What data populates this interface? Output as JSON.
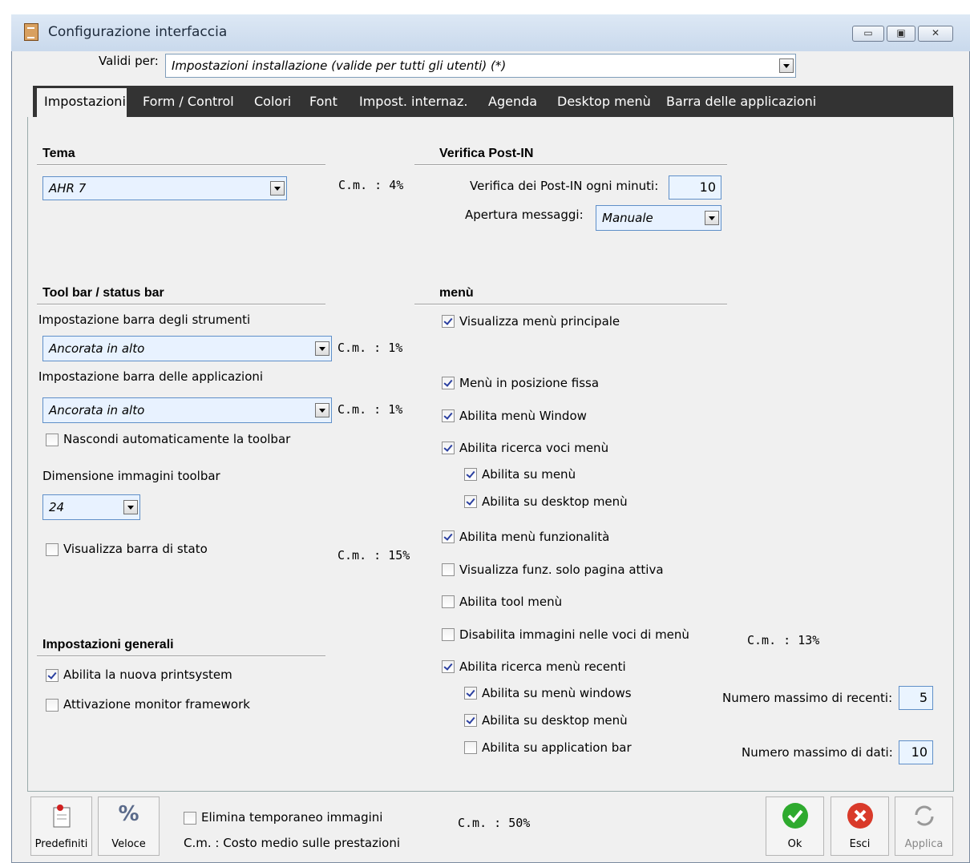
{
  "window": {
    "title": "Configurazione interfaccia",
    "controls": [
      "minimize",
      "maximize",
      "close"
    ]
  },
  "valid_for": {
    "label": "Validi per:",
    "value": "Impostazioni installazione (valide per tutti gli utenti) (*)"
  },
  "tabs": [
    "Impostazioni",
    "Form / Control",
    "Colori",
    "Font",
    "Impost. internaz.",
    "Agenda",
    "Desktop menù",
    "Barra delle applicazioni"
  ],
  "tema": {
    "title": "Tema",
    "value": "AHR 7",
    "cm": "C.m. : 4%"
  },
  "postin": {
    "title": "Verifica Post-IN",
    "minutes_label": "Verifica dei Post-IN ogni minuti:",
    "minutes": "10",
    "open_label": "Apertura messaggi:",
    "open_value": "Manuale"
  },
  "toolbar": {
    "title": "Tool bar / status bar",
    "strumenti_label": "Impostazione barra degli strumenti",
    "strumenti_value": "Ancorata in alto",
    "strumenti_cm": "C.m. : 1%",
    "applicazioni_label": "Impostazione barra delle applicazioni",
    "applicazioni_value": "Ancorata in alto",
    "applicazioni_cm": "C.m. : 1%",
    "hide_label": "Nascondi automaticamente la toolbar",
    "img_label": "Dimensione immagini toolbar",
    "img_value": "24",
    "statusbar_label": "Visualizza barra di stato",
    "cm": "C.m. : 15%"
  },
  "menu": {
    "title": "menù",
    "items": [
      "Visualizza menù principale",
      "Menù in posizione fissa",
      "Abilita menù Window",
      "Abilita ricerca voci menù",
      "Abilita su menù",
      "Abilita su desktop menù",
      "Abilita menù funzionalità",
      "Visualizza funz. solo pagina attiva",
      "Abilita tool menù",
      "Disabilita immagini nelle voci di menù",
      "Abilita ricerca menù recenti",
      "Abilita su menù windows",
      "Abilita su desktop menù",
      "Abilita su application bar"
    ],
    "cm": "C.m. : 13%",
    "recent_label": "Numero massimo di recenti:",
    "recent_value": "5",
    "data_label": "Numero massimo di dati:",
    "data_value": "10"
  },
  "general": {
    "title": "Impostazioni generali",
    "printsystem": "Abilita la nuova printsystem",
    "monitor": "Attivazione monitor framework"
  },
  "footer": {
    "predefiniti": "Predefiniti",
    "veloce": "Veloce",
    "elimina": "Elimina temporaneo immagini",
    "legend": "C.m. : Costo medio sulle prestazioni",
    "cm": "C.m. : 50%",
    "ok": "Ok",
    "esci": "Esci",
    "applica": "Applica"
  },
  "colors": {
    "tabbar": "#333333",
    "ok": "#2eaa2e",
    "esci": "#d93a2a",
    "input_bg": "#e8f2ff"
  }
}
